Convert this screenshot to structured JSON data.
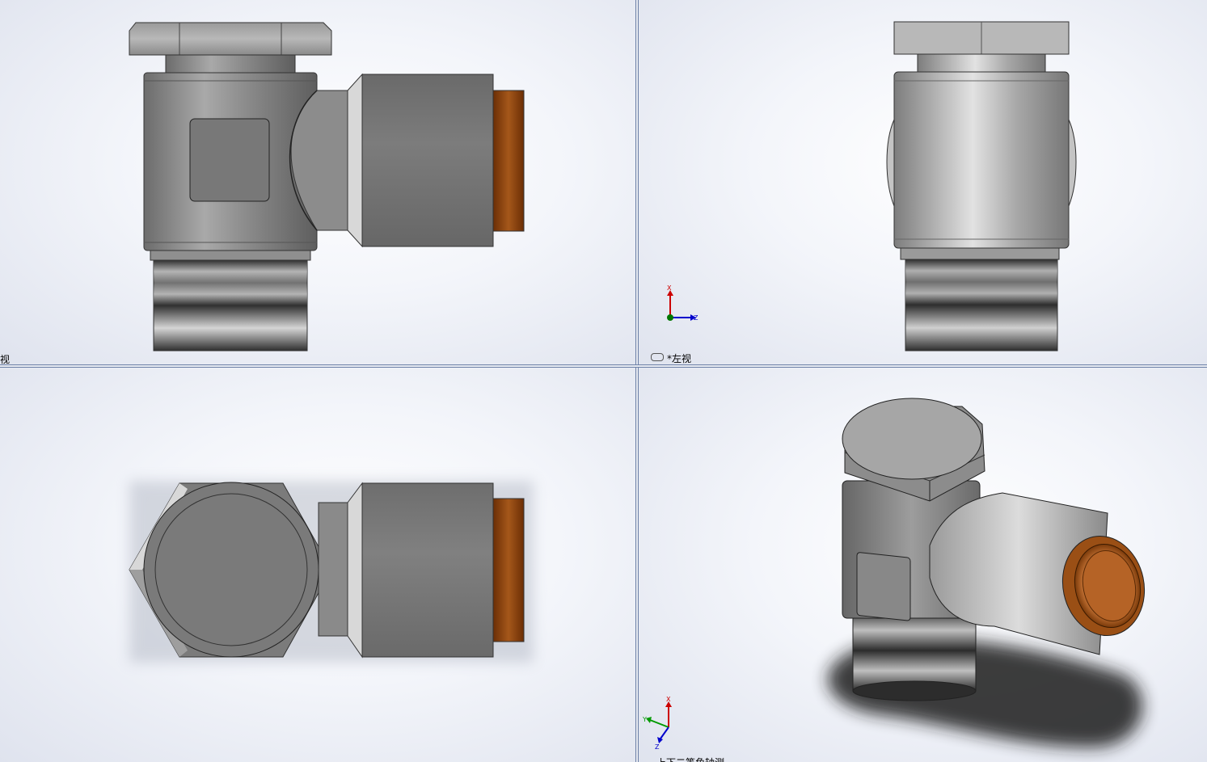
{
  "viewports": {
    "front": {
      "label": "视"
    },
    "left": {
      "label": "*左视"
    },
    "top": {
      "label": ""
    },
    "iso": {
      "label": "上下二等角轴测"
    }
  },
  "triad": {
    "x": "X",
    "y": "Y",
    "z": "Z"
  },
  "colors": {
    "body_gray": "#7a7a7a",
    "light_gray": "#c8c8c8",
    "copper": "#7a3a0a",
    "axis_x": "#cc0000",
    "axis_y": "#009900",
    "axis_z": "#0000cc"
  }
}
